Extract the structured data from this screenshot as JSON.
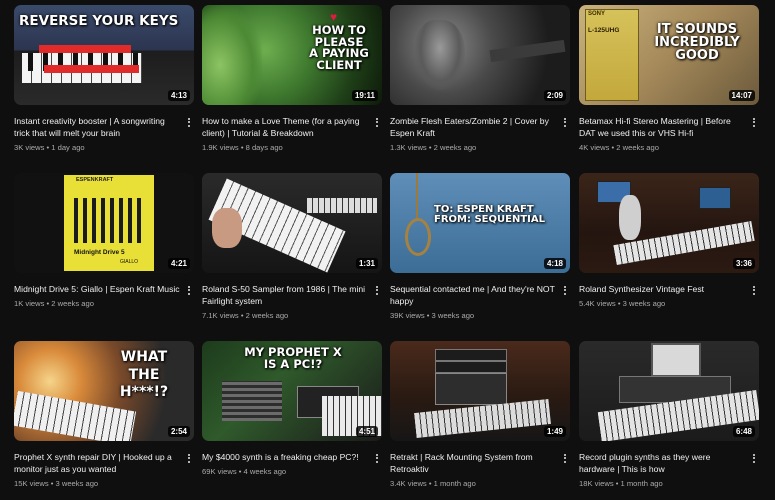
{
  "videos": [
    {
      "title": "Instant creativity booster | A songwriting trick that will melt your brain",
      "views": "3K views",
      "age": "1 day ago",
      "duration": "4:13",
      "thumb_text": "REVERSE YOUR KEYS"
    },
    {
      "title": "How to make a Love Theme (for a paying client) | Tutorial & Breakdown",
      "views": "1.9K views",
      "age": "8 days ago",
      "duration": "19:11",
      "thumb_text": "HOW TO\nPLEASE\nA PAYING\nCLIENT"
    },
    {
      "title": "Zombie Flesh Eaters/Zombie 2 | Cover by Espen Kraft",
      "views": "1.3K views",
      "age": "2 weeks ago",
      "duration": "2:09",
      "thumb_text": ""
    },
    {
      "title": "Betamax Hi-fi Stereo Mastering | Before DAT we used this or VHS Hi-fi",
      "views": "4K views",
      "age": "2 weeks ago",
      "duration": "14:07",
      "thumb_text": "IT SOUNDS\nINCREDIBLY\nGOOD",
      "thumb_label": "SONY",
      "thumb_label2": "L-125UHG"
    },
    {
      "title": "Midnight Drive 5: Giallo | Espen Kraft Music",
      "views": "1K views",
      "age": "2 weeks ago",
      "duration": "4:21",
      "thumb_text": "Midnight Drive 5",
      "thumb_label": "ESPENKRAFT",
      "thumb_label2": "GIALLO"
    },
    {
      "title": "Roland S-50 Sampler from 1986 | The mini Fairlight system",
      "views": "7.1K views",
      "age": "2 weeks ago",
      "duration": "1:31",
      "thumb_text": ""
    },
    {
      "title": "Sequential contacted me | And they're NOT happy",
      "views": "39K views",
      "age": "3 weeks ago",
      "duration": "4:18",
      "thumb_text": "TO: ESPEN KRAFT\nFROM: SEQUENTIAL"
    },
    {
      "title": "Roland Synthesizer Vintage Fest",
      "views": "5.4K views",
      "age": "3 weeks ago",
      "duration": "3:36",
      "thumb_text": ""
    },
    {
      "title": "Prophet X synth repair DIY | Hooked up a monitor just as you wanted",
      "views": "15K views",
      "age": "3 weeks ago",
      "duration": "2:54",
      "thumb_text": "WHAT\nTHE\nH***!?"
    },
    {
      "title": "My $4000 synth is a freaking cheap PC?!",
      "views": "69K views",
      "age": "4 weeks ago",
      "duration": "4:51",
      "thumb_text": "MY PROPHET X\nIS A PC!?"
    },
    {
      "title": "Retrakt | Rack Mounting System from Retroaktiv",
      "views": "3.4K views",
      "age": "1 month ago",
      "duration": "1:49",
      "thumb_text": ""
    },
    {
      "title": "Record plugin synths as they were hardware | This is how",
      "views": "18K views",
      "age": "1 month ago",
      "duration": "6:48",
      "thumb_text": ""
    }
  ]
}
